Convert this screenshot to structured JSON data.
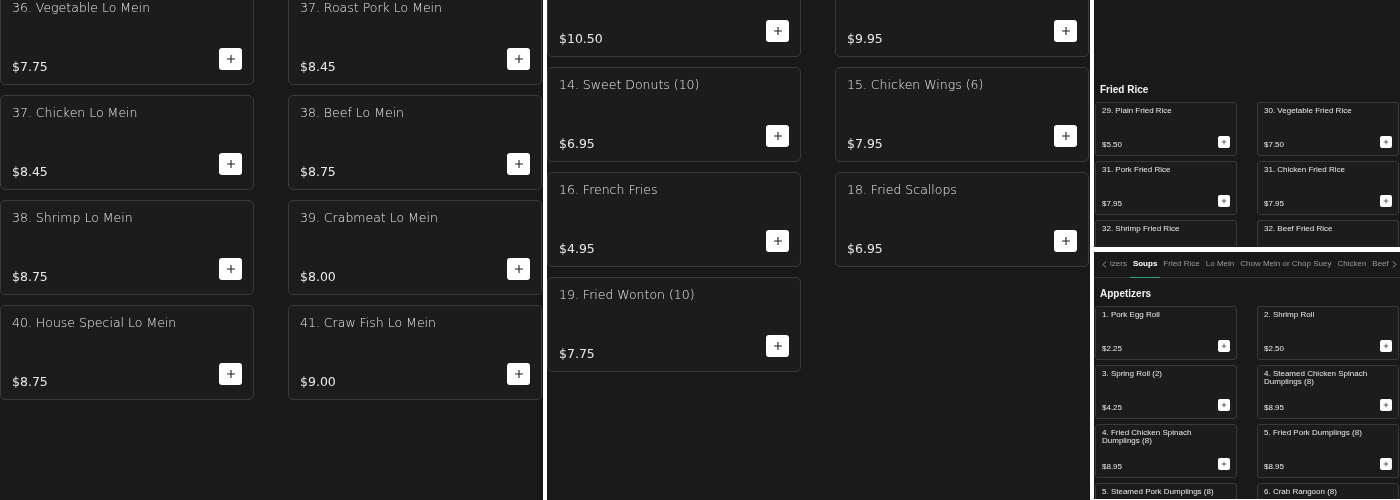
{
  "panels": [
    {
      "kind": "large",
      "sections": [
        {
          "items": [
            {
              "title": "36. Vegetable Lo Mein",
              "price": "$7.75"
            },
            {
              "title": "37. Roast Pork Lo Mein",
              "price": "$8.45"
            },
            {
              "title": "37. Chicken Lo Mein",
              "price": "$8.45"
            },
            {
              "title": "38. Beef Lo Mein",
              "price": "$8.75"
            },
            {
              "title": "38. Shrimp Lo Mein",
              "price": "$8.75"
            },
            {
              "title": "39. Crabmeat Lo Mein",
              "price": "$8.00"
            },
            {
              "title": "40. House Special Lo Mein",
              "price": "$8.75"
            },
            {
              "title": "41. Craw Fish Lo Mein",
              "price": "$9.00"
            }
          ]
        }
      ]
    },
    {
      "kind": "large",
      "sections": [
        {
          "items": [
            {
              "price": "$10.50"
            },
            {
              "price": "$9.95"
            },
            {
              "title": "14. Sweet Donuts (10)",
              "price": "$6.95"
            },
            {
              "title": "15. Chicken Wings (6)",
              "price": "$7.95"
            },
            {
              "title": "16. French Fries",
              "price": "$4.95"
            },
            {
              "title": "18. Fried Scallops",
              "price": "$6.95"
            },
            {
              "title": "19. Fried Wonton (10)",
              "price": "$7.75"
            }
          ]
        }
      ]
    },
    {
      "kind": "small",
      "sections": [
        {
          "heading": "Fried Rice",
          "items": [
            {
              "title": "29. Plain Fried Rice",
              "price": "$5.50"
            },
            {
              "title": "30. Vegetable Fried Rice",
              "price": "$7.50"
            },
            {
              "title": "31. Pork Fried Rice",
              "price": "$7.95"
            },
            {
              "title": "31. Chicken Fried Rice",
              "price": "$7.95"
            },
            {
              "title": "32. Shrimp Fried Rice"
            },
            {
              "title": "32. Beef Fried Rice"
            }
          ]
        }
      ]
    },
    {
      "kind": "small",
      "tabs": [
        {
          "label": "izers",
          "selected": false
        },
        {
          "label": "Soups",
          "selected": true
        },
        {
          "label": "Fried Rice",
          "selected": false
        },
        {
          "label": "Lo Mein",
          "selected": false
        },
        {
          "label": "Chow Mein or Chop Suey",
          "selected": false
        },
        {
          "label": "Chicken",
          "selected": false
        },
        {
          "label": "Beef",
          "selected": false
        }
      ],
      "sections": [
        {
          "heading": "Appetizers",
          "items": [
            {
              "title": "1. Pork Egg Roll",
              "price": "$2.25"
            },
            {
              "title": "2. Shrimp Roll",
              "price": "$2.50"
            },
            {
              "title": "3. Spring Roll (2)",
              "price": "$4.25"
            },
            {
              "title": "4. Steamed Chicken Spinach Dumplings (8)",
              "price": "$8.95"
            },
            {
              "title": "4. Fried Chicken Spinach Dumplings (8)",
              "price": "$8.95"
            },
            {
              "title": "5. Fried Pork Dumplings (8)",
              "price": "$8.95"
            },
            {
              "title": "5. Steamed Pork Dumplings (8)"
            },
            {
              "title": "6. Crab Rangoon (8)"
            }
          ]
        }
      ]
    }
  ]
}
